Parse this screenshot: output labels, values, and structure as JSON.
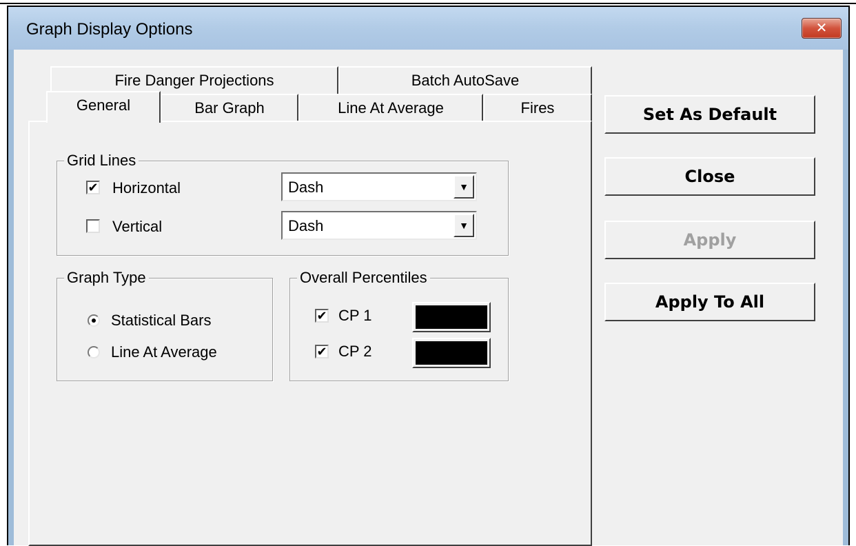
{
  "window": {
    "title": "Graph Display Options",
    "close_icon": "close-icon (×)"
  },
  "tabs": {
    "row_back": [
      "Fire Danger Projections",
      "Batch AutoSave"
    ],
    "row_front": [
      "General",
      "Bar Graph",
      "Line At Average",
      "Fires"
    ],
    "active": "General"
  },
  "grid_lines": {
    "label": "Grid Lines",
    "horizontal": {
      "label": "Horizontal",
      "checked": true,
      "style": "Dash"
    },
    "vertical": {
      "label": "Vertical",
      "checked": false,
      "style": "Dash"
    }
  },
  "graph_type": {
    "label": "Graph Type",
    "options": [
      "Statistical Bars",
      "Line At Average"
    ],
    "selected": "Statistical Bars"
  },
  "overall_percentiles": {
    "label": "Overall Percentiles",
    "cp1": {
      "label": "CP 1",
      "checked": true,
      "color": "#000000"
    },
    "cp2": {
      "label": "CP 2",
      "checked": true,
      "color": "#000000"
    }
  },
  "buttons": {
    "set_default": "Set As Default",
    "close": "Close",
    "apply": "Apply",
    "apply_all": "Apply To All"
  }
}
